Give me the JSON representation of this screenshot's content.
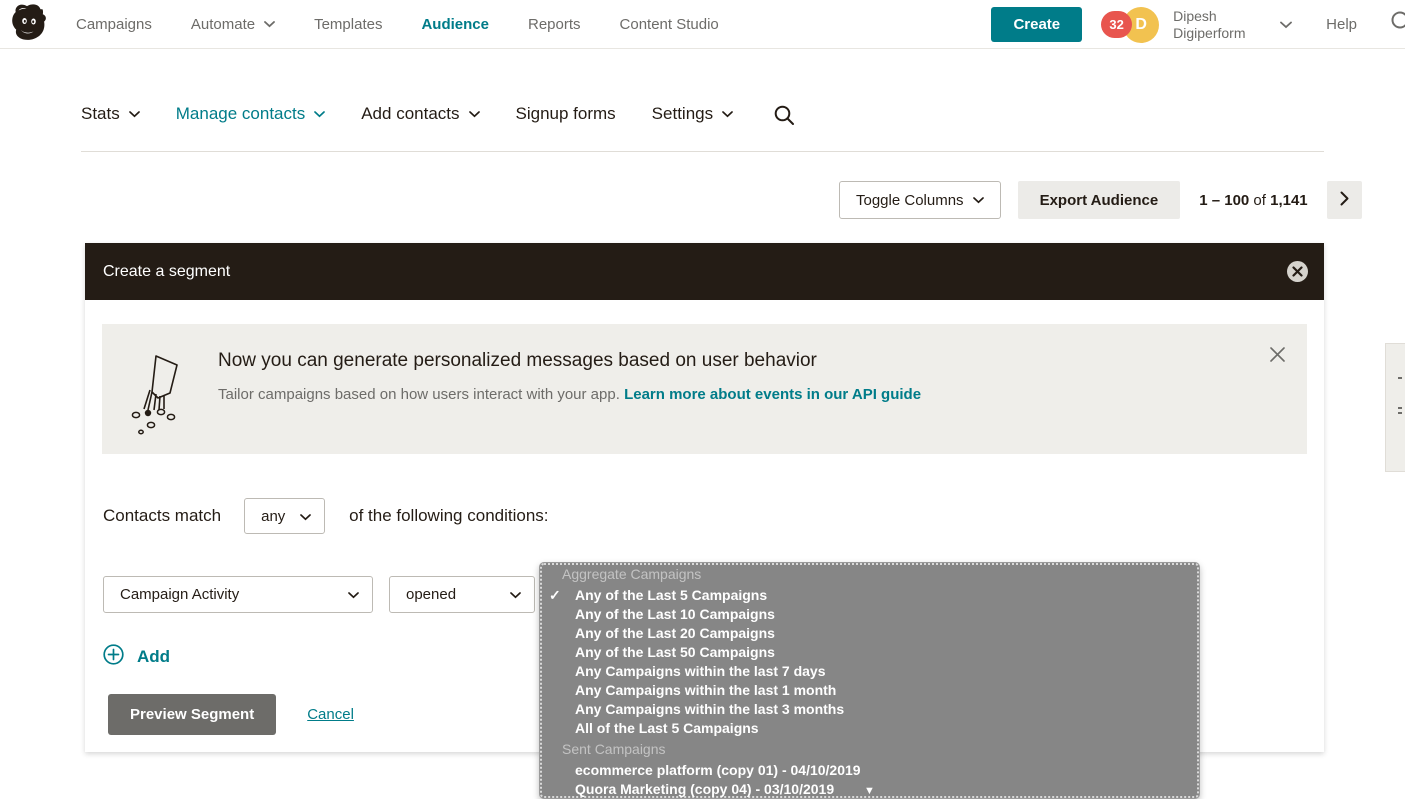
{
  "header": {
    "logo": "mailchimp-freddie-logo",
    "nav": [
      {
        "label": "Campaigns",
        "has_caret": false,
        "active": false
      },
      {
        "label": "Automate",
        "has_caret": true,
        "active": false
      },
      {
        "label": "Templates",
        "has_caret": false,
        "active": false
      },
      {
        "label": "Audience",
        "has_caret": false,
        "active": true
      },
      {
        "label": "Reports",
        "has_caret": false,
        "active": false
      },
      {
        "label": "Content Studio",
        "has_caret": false,
        "active": false
      }
    ],
    "create_label": "Create",
    "badge_count": "32",
    "avatar_initial": "D",
    "account_name": "Dipesh Digiperform",
    "help_label": "Help",
    "search_icon": "search-icon",
    "accent_color": "#007c89",
    "badge_color": "#e8554e",
    "avatar_color": "#f2c250"
  },
  "subnav": {
    "items": [
      {
        "label": "Stats",
        "has_caret": true,
        "active": false
      },
      {
        "label": "Manage contacts",
        "has_caret": true,
        "active": true
      },
      {
        "label": "Add contacts",
        "has_caret": true,
        "active": false
      },
      {
        "label": "Signup forms",
        "has_caret": false,
        "active": false
      },
      {
        "label": "Settings",
        "has_caret": true,
        "active": false
      }
    ],
    "search_icon": "search-icon"
  },
  "toolbar": {
    "toggle_columns_label": "Toggle Columns",
    "export_label": "Export Audience",
    "pagination_range": "1 – 100",
    "pagination_of": "of",
    "pagination_total": "1,141",
    "next_icon": "chevron-right-icon"
  },
  "panel": {
    "title": "Create a segment",
    "close_icon": "close-icon"
  },
  "notice": {
    "icon": "hand-sprinkling-seeds-illustration",
    "title": "Now you can generate personalized messages based on user behavior",
    "subtitle": "Tailor campaigns based on how users interact with your app.",
    "link_label": "Learn more about events in our API guide",
    "close_icon": "close-icon"
  },
  "segment": {
    "match_label": "Contacts match",
    "match_value": "any",
    "match_tail": "of the following conditions:",
    "condition": {
      "field": "Campaign Activity",
      "operator": "opened",
      "value": "Any of the Last 5 Campaigns"
    },
    "add_label": "Add",
    "add_icon": "plus-circle-icon",
    "preview_label": "Preview Segment",
    "cancel_label": "Cancel"
  },
  "dropdown": {
    "scroll_icon": "triangle-down-icon",
    "groups": [
      {
        "label": "Aggregate Campaigns",
        "options": [
          {
            "label": "Any of the Last 5 Campaigns",
            "selected": true
          },
          {
            "label": "Any of the Last 10 Campaigns",
            "selected": false
          },
          {
            "label": "Any of the Last 20 Campaigns",
            "selected": false
          },
          {
            "label": "Any of the Last 50 Campaigns",
            "selected": false
          },
          {
            "label": "Any Campaigns within the last 7 days",
            "selected": false
          },
          {
            "label": "Any Campaigns within the last 1 month",
            "selected": false
          },
          {
            "label": "Any Campaigns within the last 3 months",
            "selected": false
          },
          {
            "label": "All of the Last 5 Campaigns",
            "selected": false
          }
        ]
      },
      {
        "label": "Sent Campaigns",
        "options": [
          {
            "label": "ecommerce platform (copy 01) - 04/10/2019",
            "selected": false
          },
          {
            "label": "Quora Marketing (copy 04) - 03/10/2019",
            "selected": false
          }
        ]
      }
    ]
  }
}
